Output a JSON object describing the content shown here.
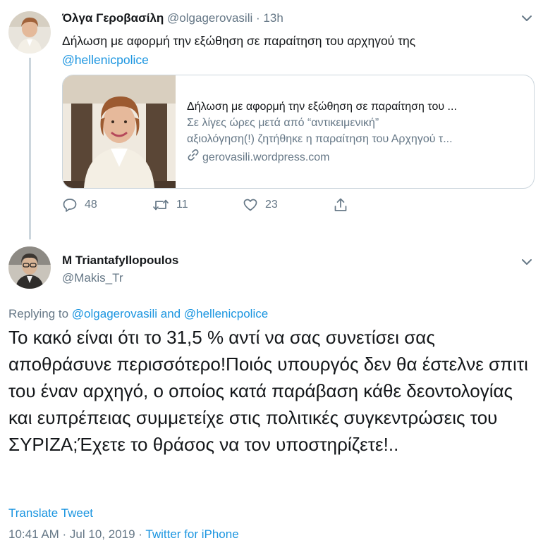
{
  "tweet1": {
    "name": "Όλγα Γεροβασίλη",
    "handle": "@olgagerovasili",
    "separator": "·",
    "time": "13h",
    "text": "Δήλωση με αφορμή την εξώθηση σε παραίτηση του αρχηγού της",
    "mention": "@hellenicpolice",
    "card": {
      "title": "Δήλωση με αφορμή την εξώθηση σε παραίτηση του ...",
      "desc_line1": "Σε λίγες ώρες μετά από “αντικειμενική”",
      "desc_line2": "αξιολόγηση(!) ζητήθηκε η παραίτηση του Αρχηγού τ...",
      "url": "gerovasili.wordpress.com"
    },
    "actions": {
      "replies": "48",
      "retweets": "11",
      "likes": "23"
    }
  },
  "tweet2": {
    "name": "M Triantafyllopoulos",
    "handle": "@Makis_Tr",
    "replying_prefix": "Replying to",
    "replying_user1": "@olgagerovasili",
    "replying_and": "and",
    "replying_user2": "@hellenicpolice",
    "text": "Το κακό είναι ότι το 31,5 % αντί να  σας συνετίσει  σας αποθράσυνε περισσότερο!Ποιός υπουργός δεν θα έστελνε σπιτι του έναν αρχηγό, ο οποίος κατά παράβαση κάθε δεοντολογίας και ευπρέπειας συμμετείχε στις πολιτικές συγκεντρώσεις του ΣΥΡΙΖΑ;Έχετε το θράσος να τον υποστηρίζετε!..",
    "translate": "Translate Tweet",
    "timestamp": "10:41 AM · Jul 10, 2019",
    "meta_separator": " · ",
    "source": "Twitter for iPhone"
  },
  "colors": {
    "link": "#1b95e0",
    "secondary": "#657786",
    "primary_text": "#14171a",
    "border": "#ccd6dd"
  }
}
